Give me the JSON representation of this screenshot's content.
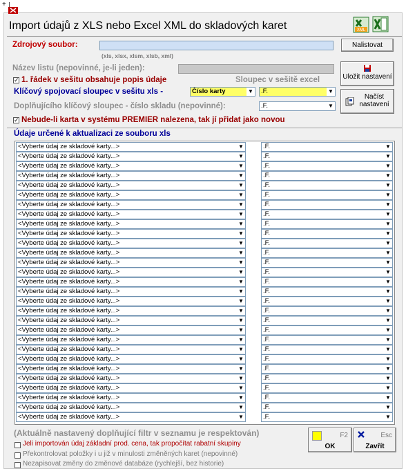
{
  "window": {
    "title": "Import údajů z XLS nebo Excel XML do skladových karet",
    "top_symbol": "+"
  },
  "source": {
    "label": "Zdrojový soubor:",
    "value": "",
    "browse_button": "Nalistovat",
    "extensions_hint": "(xls, xlsx, xlsm, xlsb, xml)"
  },
  "sheet": {
    "label": "Název listu (nepovinné, je-li jeden):",
    "value": ""
  },
  "first_row_checkbox": {
    "label": "1. řádek v sešitu obsahuje popis údaje",
    "checked": true
  },
  "column_header_right": "Sloupec v sešitě excel",
  "key_column": {
    "label": "Klíčový spojovací sloupec v sešitu xls -",
    "field_value": "Číslo karty",
    "column_value": ".F."
  },
  "secondary_key": {
    "label": "Doplňujícího klíčový sloupec - číslo skladu (nepovinné):",
    "column_value": ".F."
  },
  "add_new_checkbox": {
    "label": "Nebude-li karta v systému PREMIER nalezena, tak jí přidat jako novou",
    "checked": true
  },
  "save_settings_button": "Uložit nastavení",
  "load_settings_button": "Načíst nastavení",
  "mapping_section_label": "Údaje určené k aktualizaci ze souboru xls",
  "mapping_rows": [
    {
      "field": "<Vyberte údaj ze skladové karty...>",
      "column": ".F."
    },
    {
      "field": "<Vyberte údaj ze skladové karty...>",
      "column": ".F."
    },
    {
      "field": "<Vyberte údaj ze skladové karty...>",
      "column": ".F."
    },
    {
      "field": "<Vyberte údaj ze skladové karty...>",
      "column": ".F."
    },
    {
      "field": "<Vyberte údaj ze skladové karty...>",
      "column": ".F."
    },
    {
      "field": "<Vyberte údaj ze skladové karty...>",
      "column": ".F."
    },
    {
      "field": "<Vyberte údaj ze skladové karty...>",
      "column": ".F."
    },
    {
      "field": "<Vyberte údaj ze skladové karty...>",
      "column": ".F."
    },
    {
      "field": "<Vyberte údaj ze skladové karty...>",
      "column": ".F."
    },
    {
      "field": "<Vyberte údaj ze skladové karty...>",
      "column": ".F."
    },
    {
      "field": "<Vyberte údaj ze skladové karty...>",
      "column": ".F."
    },
    {
      "field": "<Vyberte údaj ze skladové karty...>",
      "column": ".F."
    },
    {
      "field": "<Vyberte údaj ze skladové karty...>",
      "column": ".F."
    },
    {
      "field": "<Vyberte údaj ze skladové karty...>",
      "column": ".F."
    },
    {
      "field": "<Vyberte údaj ze skladové karty...>",
      "column": ".F."
    },
    {
      "field": "<Vyberte údaj ze skladové karty...>",
      "column": ".F."
    },
    {
      "field": "<Vyberte údaj ze skladové karty...>",
      "column": ".F."
    },
    {
      "field": "<Vyberte údaj ze skladové karty...>",
      "column": ".F."
    },
    {
      "field": "<Vyberte údaj ze skladové karty...>",
      "column": ".F."
    },
    {
      "field": "<Vyberte údaj ze skladové karty...>",
      "column": ".F."
    },
    {
      "field": "<Vyberte údaj ze skladové karty...>",
      "column": ".F."
    },
    {
      "field": "<Vyberte údaj ze skladové karty...>",
      "column": ".F."
    },
    {
      "field": "<Vyberte údaj ze skladové karty...>",
      "column": ".F."
    },
    {
      "field": "<Vyberte údaj ze skladové karty...>",
      "column": ".F."
    },
    {
      "field": "<Vyberte údaj ze skladové karty...>",
      "column": ".F."
    },
    {
      "field": "<Vyberte údaj ze skladové karty...>",
      "column": ".F."
    },
    {
      "field": "<Vyberte údaj ze skladové karty...>",
      "column": ".F."
    },
    {
      "field": "<Vyberte údaj ze skladové karty...>",
      "column": ".F."
    },
    {
      "field": "<Vyberte údaj ze skladové karty...>",
      "column": ".F."
    }
  ],
  "filter_note": "(Aktuálně nastavený doplňující filtr v seznamu je respektován)",
  "options": [
    {
      "label": "Jeli importován údaj základní prod. cena, tak propočítat rabatní skupiny",
      "checked": false
    },
    {
      "label": "Překontrolovat položky i u již v minulosti změněných karet (nepovinné)",
      "checked": false
    },
    {
      "label": "Nezapisovat změny do změnové databáze (rychlejší, bez historie)",
      "checked": false
    }
  ],
  "ok_button": {
    "shortcut": "F2",
    "label": "OK"
  },
  "close_button": {
    "shortcut": "Esc",
    "label": "Zavřít"
  },
  "colors": {
    "accent_red": "#c00000",
    "accent_blue": "#000099",
    "highlight_yellow": "#ffff66"
  }
}
